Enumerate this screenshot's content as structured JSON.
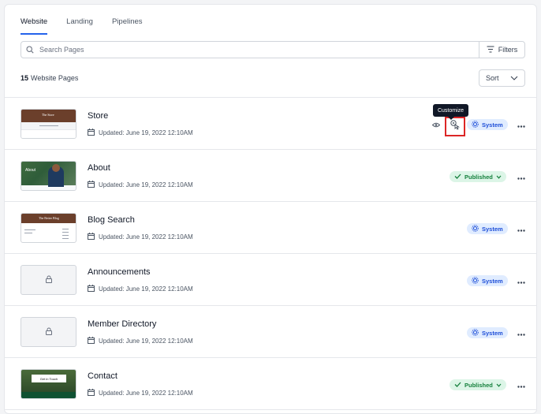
{
  "tabs": [
    {
      "label": "Website"
    },
    {
      "label": "Landing"
    },
    {
      "label": "Pipelines"
    }
  ],
  "search": {
    "placeholder": "Search Pages",
    "value": ""
  },
  "filters_label": "Filters",
  "page_count": {
    "number": "15",
    "label": "Website Pages"
  },
  "sort": {
    "label": "Sort"
  },
  "tooltip": "Customize",
  "rows": [
    {
      "name": "Store",
      "updated": "Updated: June 19, 2022 12:10AM",
      "status": "System",
      "thumb_text": "The Store",
      "thumb_sub": "Available Items"
    },
    {
      "name": "About",
      "updated": "Updated: June 19, 2022 12:10AM",
      "status": "Published",
      "thumb_text": "About"
    },
    {
      "name": "Blog Search",
      "updated": "Updated: June 19, 2022 12:10AM",
      "status": "System",
      "thumb_text": "The Better Blog"
    },
    {
      "name": "Announcements",
      "updated": "Updated: June 19, 2022 12:10AM",
      "status": "System"
    },
    {
      "name": "Member Directory",
      "updated": "Updated: June 19, 2022 12:10AM",
      "status": "System"
    },
    {
      "name": "Contact",
      "updated": "Updated: June 19, 2022 12:10AM",
      "status": "Published",
      "thumb_text": "Get in Touch"
    }
  ],
  "colors": {
    "accent": "#2563eb",
    "system_bg": "#e0ecff",
    "system_fg": "#1d4ed8",
    "published_bg": "#dcf5e7",
    "published_fg": "#15803d",
    "highlight": "#dc2626"
  },
  "icons": [
    "search-icon",
    "filter-icon",
    "chevron-down-icon",
    "calendar-icon",
    "eye-icon",
    "customize-icon",
    "gear-icon",
    "check-icon",
    "more-icon",
    "lock-icon"
  ]
}
